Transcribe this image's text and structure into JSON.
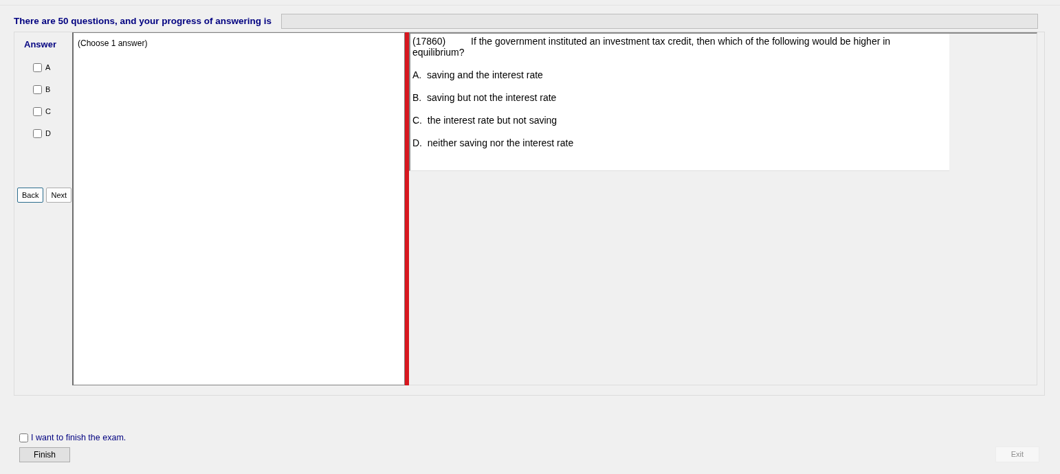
{
  "header": {
    "text": "There are 50 questions, and your progress of answering is"
  },
  "progress": {
    "level": 0
  },
  "answer_panel": {
    "title": "Answer",
    "options": [
      {
        "label": "A",
        "checked": false
      },
      {
        "label": "B",
        "checked": false
      },
      {
        "label": "C",
        "checked": false
      },
      {
        "label": "D",
        "checked": false
      }
    ],
    "buttons": [
      "Back",
      "Next"
    ]
  },
  "answer_box": {
    "text": "(Choose 1 answer)"
  },
  "question": {
    "number": "(17860)",
    "text": "If the government instituted an investment tax credit, then which of the following would be higher in equilibrium?",
    "choices": [
      "A.  saving and the interest rate",
      "B.  saving but not the interest rate",
      "C.  the interest rate but not saving",
      "D.  neither saving nor the interest rate"
    ]
  },
  "finish": {
    "label": "I want to finish the exam.",
    "checked": false,
    "button": "Finish"
  },
  "exit_button": "Exit"
}
